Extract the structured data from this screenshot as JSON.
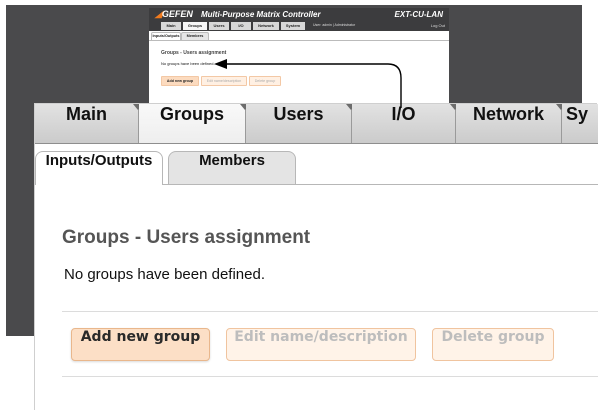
{
  "app": {
    "brand": "GEFEN",
    "title": "Multi-Purpose Matrix Controller",
    "model": "EXT-CU-LAN",
    "user_info": "User: admin  |  Administrator",
    "logout": "Log Out"
  },
  "tabs": [
    {
      "label": "Main",
      "active": false
    },
    {
      "label": "Groups",
      "active": true
    },
    {
      "label": "Users",
      "active": false
    },
    {
      "label": "I/O",
      "active": false
    },
    {
      "label": "Network",
      "active": false
    },
    {
      "label": "System",
      "active": false
    }
  ],
  "zoom_tabs": [
    {
      "label": "Main"
    },
    {
      "label": "Groups"
    },
    {
      "label": "Users"
    },
    {
      "label": "I/O"
    },
    {
      "label": "Network"
    },
    {
      "label": "Sy"
    }
  ],
  "subtabs": [
    {
      "label": "Inputs/Outputs",
      "active": true
    },
    {
      "label": "Members",
      "active": false
    }
  ],
  "content": {
    "heading": "Groups - Users assignment",
    "message": "No groups have been defined."
  },
  "buttons": {
    "add": "Add new group",
    "edit": "Edit name/description",
    "delete": "Delete group"
  },
  "colors": {
    "brand_orange": "#f07a1d",
    "button_primary": "#fcdfc6",
    "button_disabled": "#fff3e8",
    "background_dark": "#4a4a4c"
  }
}
